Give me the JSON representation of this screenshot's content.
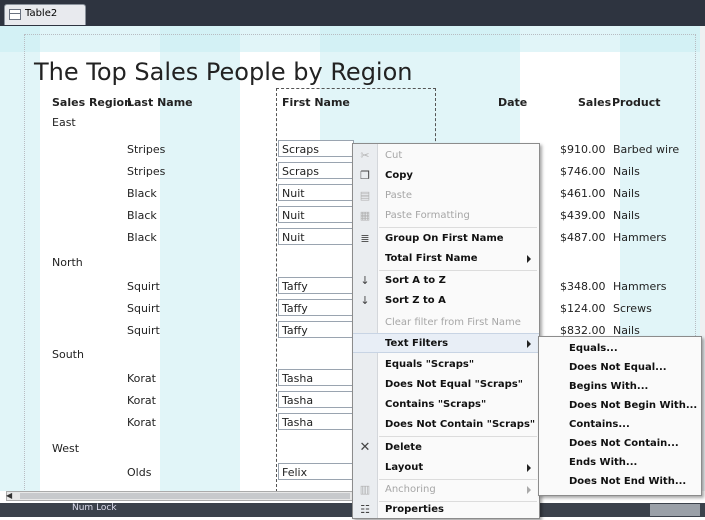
{
  "window": {
    "tab_label": "Table2",
    "status_text": "Num Lock"
  },
  "report": {
    "title": "The Top Sales People by Region",
    "headers": [
      "Sales Region",
      "Last Name",
      "First Name",
      "Date",
      "Sales",
      "Product"
    ],
    "groups": [
      "East",
      "North",
      "South",
      "West"
    ],
    "rows": [
      {
        "last": "Stripes",
        "first": "Scraps",
        "sales": "$910.00",
        "product": "Barbed wire"
      },
      {
        "last": "Stripes",
        "first": "Scraps",
        "sales": "$746.00",
        "product": "Nails"
      },
      {
        "last": "Black",
        "first": "Nuit",
        "sales": "$461.00",
        "product": "Nails"
      },
      {
        "last": "Black",
        "first": "Nuit",
        "sales": "$439.00",
        "product": "Nails"
      },
      {
        "last": "Black",
        "first": "Nuit",
        "sales": "$487.00",
        "product": "Hammers"
      },
      {
        "last": "Squirt",
        "first": "Taffy",
        "sales": "$348.00",
        "product": "Hammers"
      },
      {
        "last": "Squirt",
        "first": "Taffy",
        "sales": "$124.00",
        "product": "Screws"
      },
      {
        "last": "Squirt",
        "first": "Taffy",
        "sales": "$832.00",
        "product": "Nails"
      },
      {
        "last": "Korat",
        "first": "Tasha",
        "sales": "",
        "product": ""
      },
      {
        "last": "Korat",
        "first": "Tasha",
        "sales": "",
        "product": ""
      },
      {
        "last": "Korat",
        "first": "Tasha",
        "sales": "",
        "product": ""
      },
      {
        "last": "Olds",
        "first": "Felix",
        "sales": "",
        "product": ""
      }
    ]
  },
  "context_menu": {
    "items": [
      {
        "label": "Cut",
        "icon": "scissors-icon",
        "enabled": false,
        "submenu": false
      },
      {
        "label": "Copy",
        "icon": "copy-icon",
        "enabled": true,
        "submenu": false
      },
      {
        "label": "Paste",
        "icon": "paste-icon",
        "enabled": false,
        "submenu": false
      },
      {
        "label": "Paste Formatting",
        "icon": "paste-format-icon",
        "enabled": false,
        "submenu": false
      },
      {
        "label": "Group On First Name",
        "icon": "group-icon",
        "enabled": true,
        "submenu": false
      },
      {
        "label": "Total First Name",
        "icon": "",
        "enabled": true,
        "submenu": true
      },
      {
        "label": "Sort A to Z",
        "icon": "sort-asc-icon",
        "enabled": true,
        "submenu": false
      },
      {
        "label": "Sort Z to A",
        "icon": "sort-desc-icon",
        "enabled": true,
        "submenu": false
      },
      {
        "label": "Clear filter from First Name",
        "icon": "",
        "enabled": false,
        "submenu": false
      },
      {
        "label": "Text Filters",
        "icon": "",
        "enabled": true,
        "submenu": true
      },
      {
        "label": "Equals \"Scraps\"",
        "icon": "",
        "enabled": true,
        "submenu": false
      },
      {
        "label": "Does Not Equal \"Scraps\"",
        "icon": "",
        "enabled": true,
        "submenu": false
      },
      {
        "label": "Contains \"Scraps\"",
        "icon": "",
        "enabled": true,
        "submenu": false
      },
      {
        "label": "Does Not Contain \"Scraps\"",
        "icon": "",
        "enabled": true,
        "submenu": false
      },
      {
        "label": "Delete",
        "icon": "delete-icon",
        "enabled": true,
        "submenu": false
      },
      {
        "label": "Layout",
        "icon": "",
        "enabled": true,
        "submenu": true
      },
      {
        "label": "Anchoring",
        "icon": "anchor-icon",
        "enabled": false,
        "submenu": true
      },
      {
        "label": "Properties",
        "icon": "properties-icon",
        "enabled": true,
        "submenu": false
      }
    ]
  },
  "text_filters_submenu": {
    "items": [
      "Equals...",
      "Does Not Equal...",
      "Begins With...",
      "Does Not Begin With...",
      "Contains...",
      "Does Not Contain...",
      "Ends With...",
      "Does Not End With..."
    ]
  }
}
